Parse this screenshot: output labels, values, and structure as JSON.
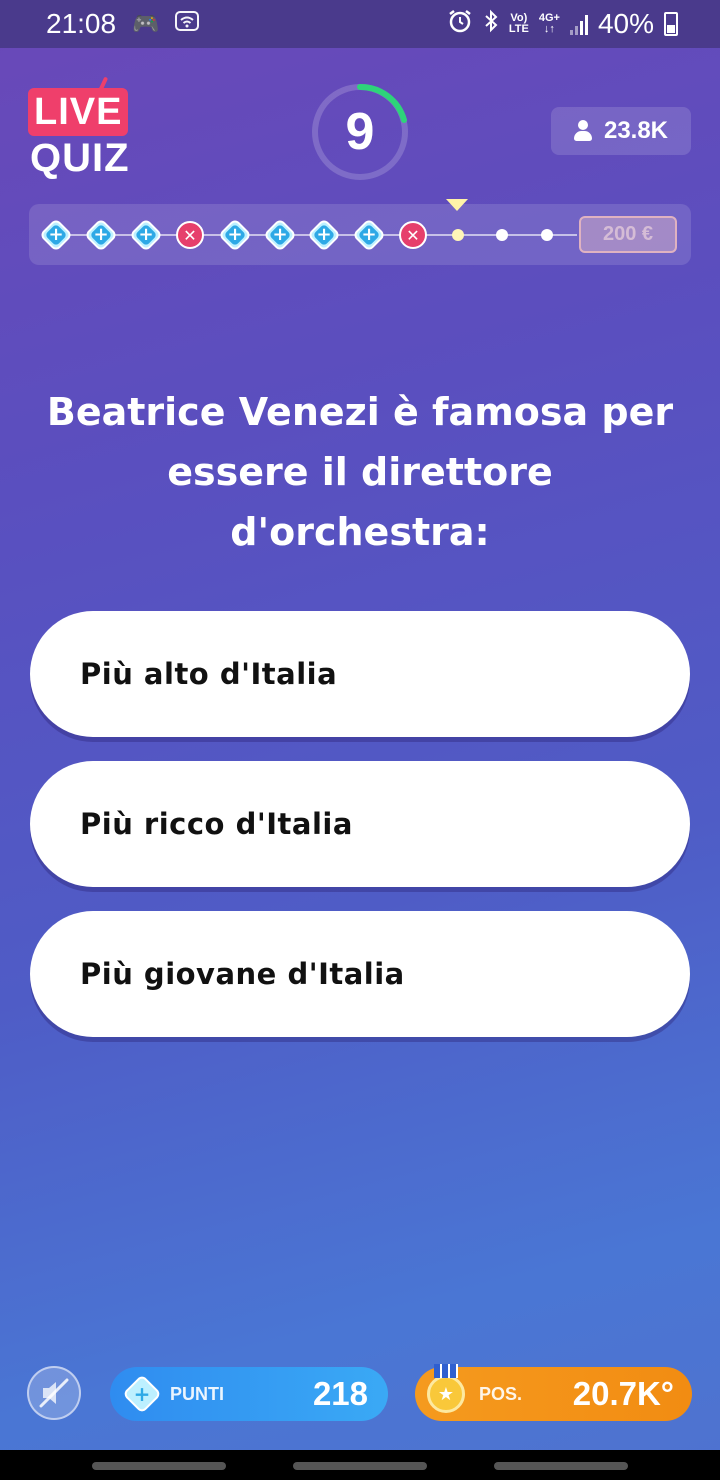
{
  "status_bar": {
    "time": "21:08",
    "battery": "40%",
    "net_top": "Vo)",
    "net_bottom": "LTE",
    "net2_top": "4G+",
    "net2_bottom": "↓↑"
  },
  "header": {
    "logo_top": "LIVE",
    "logo_bottom": "QUIZ",
    "timer_value": "9",
    "viewers": "23.8K"
  },
  "progress": {
    "prize": "200 €",
    "steps": [
      "correct",
      "correct",
      "correct",
      "wrong",
      "correct",
      "correct",
      "correct",
      "correct",
      "wrong",
      "current",
      "pending",
      "pending"
    ]
  },
  "question": {
    "text": "Beatrice Venezi è famosa per essere il direttore d'orchestra:"
  },
  "answers": [
    {
      "label": "Più alto d'Italia"
    },
    {
      "label": "Più ricco d'Italia"
    },
    {
      "label": "Più giovane d'Italia"
    }
  ],
  "footer": {
    "points_label": "PUNTI",
    "points_value": "218",
    "position_label": "POS.",
    "position_value": "20.7K°"
  },
  "colors": {
    "accent_pink": "#ef3f6b",
    "diamond_blue": "#2ea9e6",
    "timer_green": "#2ed47a",
    "points_blue": "#2f8cf0",
    "position_orange": "#f59a1e"
  }
}
